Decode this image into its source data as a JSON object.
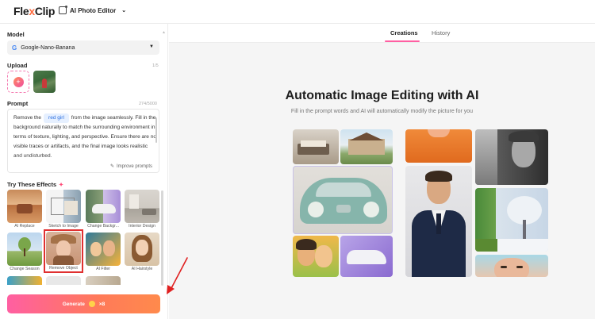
{
  "app": {
    "logo_pre": "Fle",
    "logo_x": "x",
    "logo_post": "Clip",
    "tool_name": "AI Photo Editor"
  },
  "sidebar": {
    "model_label": "Model",
    "model_value": "Google-Nano-Banana",
    "upload_label": "Upload",
    "upload_count": "1/5",
    "prompt_label": "Prompt",
    "prompt_count": "274/5000",
    "prompt_before": "Remove the",
    "prompt_chip": "red girl",
    "prompt_after": "from the image seamlessly. Fill in the background naturally to match the surrounding environment in terms of texture, lighting, and perspective. Ensure there are no visible traces or artifacts, and the final image looks realistic and undisturbed.",
    "improve_label": "Improve prompts",
    "effects_title": "Try These Effects",
    "effects": [
      {
        "label": "AI Replace"
      },
      {
        "label": "Sketch to Image"
      },
      {
        "label": "Change Backgr..."
      },
      {
        "label": "Interior Design"
      },
      {
        "label": "Change Season"
      },
      {
        "label": "Remove Object"
      },
      {
        "label": "AI Filter"
      },
      {
        "label": "AI Hairstyle"
      }
    ],
    "generate_label": "Generate",
    "generate_cost": "×8"
  },
  "main": {
    "tabs": [
      {
        "label": "Creations"
      },
      {
        "label": "History"
      }
    ],
    "title": "Automatic Image Editing with AI",
    "subtitle": "Fill in the prompt words and AI will automatically modify the picture for you"
  },
  "colors": {
    "accent_pink": "#ff5fa2",
    "accent_orange": "#ff7a59",
    "highlight_red": "#e03030"
  }
}
